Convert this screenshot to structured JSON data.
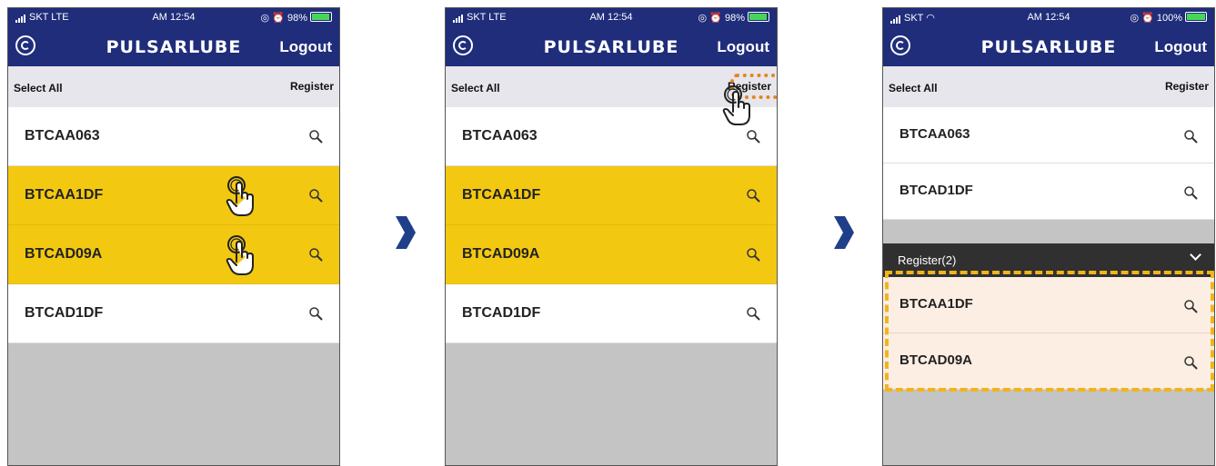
{
  "brand": "PULSARLUBE",
  "colors": {
    "navbar": "#1f2d7b",
    "selected": "#f2c811",
    "registered": "#fdeee3",
    "section": "#303030",
    "arrow": "#1f3f8a"
  },
  "panels": [
    {
      "status": {
        "carrier": "SKT  LTE",
        "time": "AM 12:54",
        "battery": "98%"
      },
      "logout": "Logout",
      "select_all": "Select All",
      "register": "Register",
      "rows": [
        {
          "label": "BTCAA063",
          "state": "normal"
        },
        {
          "label": "BTCAA1DF",
          "state": "selected"
        },
        {
          "label": "BTCAD09A",
          "state": "selected"
        },
        {
          "label": "BTCAD1DF",
          "state": "normal"
        }
      ]
    },
    {
      "status": {
        "carrier": "SKT  LTE",
        "time": "AM 12:54",
        "battery": "98%"
      },
      "logout": "Logout",
      "select_all": "Select All",
      "register": "Register",
      "rows": [
        {
          "label": "BTCAA063",
          "state": "normal"
        },
        {
          "label": "BTCAA1DF",
          "state": "selected"
        },
        {
          "label": "BTCAD09A",
          "state": "selected"
        },
        {
          "label": "BTCAD1DF",
          "state": "normal"
        }
      ]
    },
    {
      "status": {
        "carrier": "SKT",
        "time": "AM 12:54",
        "battery": "100%"
      },
      "logout": "Logout",
      "select_all": "Select All",
      "register": "Register",
      "rows": [
        {
          "label": "BTCAA063",
          "state": "normal"
        },
        {
          "label": "BTCAD1DF",
          "state": "normal"
        }
      ],
      "section_title": "Register(2)",
      "registered_rows": [
        {
          "label": "BTCAA1DF",
          "state": "registered"
        },
        {
          "label": "BTCAD09A",
          "state": "registered"
        }
      ]
    }
  ]
}
